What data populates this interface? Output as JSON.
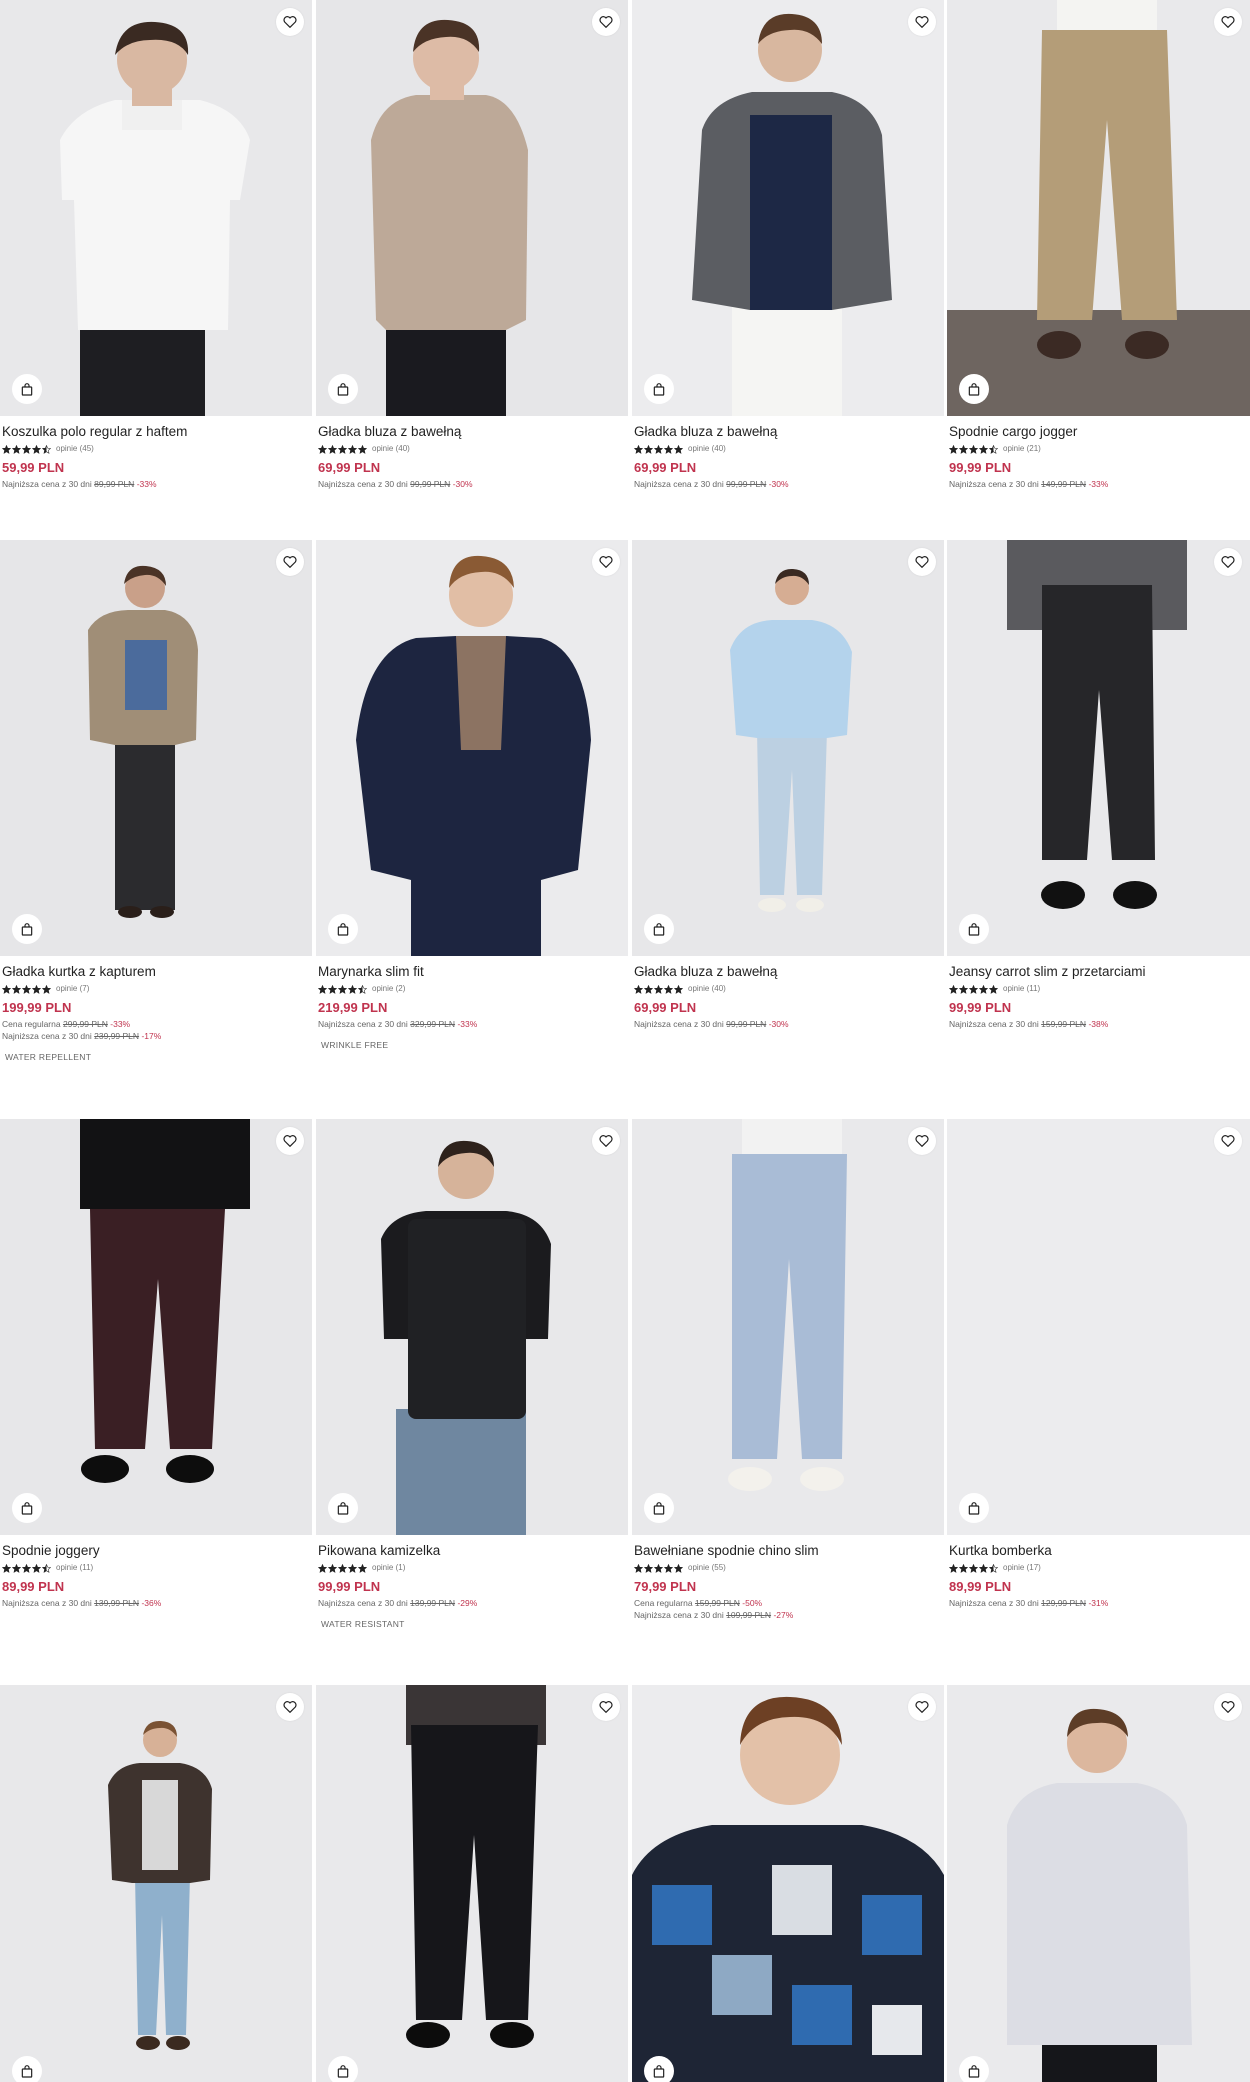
{
  "colors": {
    "accent_price": "#c0334e",
    "text": "#222222",
    "muted": "#777777",
    "card_bg": "#e9e9eb"
  },
  "icons": {
    "favorite": "heart-icon",
    "cart": "shopping-bag-icon",
    "star": "star-icon"
  },
  "products": [
    {
      "name": "Koszulka polo regular z haftem",
      "rating": 4.5,
      "reviews": "opinie (45)",
      "price": "59,99 PLN",
      "history": [
        {
          "label": "Najniższa cena z 30 dni",
          "old": "89,99 PLN",
          "discount": "-33%"
        }
      ],
      "tag": ""
    },
    {
      "name": "Gładka bluza z bawełną",
      "rating": 5,
      "reviews": "opinie (40)",
      "price": "69,99 PLN",
      "history": [
        {
          "label": "Najniższa cena z 30 dni",
          "old": "99,99 PLN",
          "discount": "-30%"
        }
      ],
      "tag": ""
    },
    {
      "name": "Gładka bluza z bawełną",
      "rating": 5,
      "reviews": "opinie (40)",
      "price": "69,99 PLN",
      "history": [
        {
          "label": "Najniższa cena z 30 dni",
          "old": "99,99 PLN",
          "discount": "-30%"
        }
      ],
      "tag": ""
    },
    {
      "name": "Spodnie cargo jogger",
      "rating": 4.5,
      "reviews": "opinie (21)",
      "price": "99,99 PLN",
      "history": [
        {
          "label": "Najniższa cena z 30 dni",
          "old": "149,99 PLN",
          "discount": "-33%"
        }
      ],
      "tag": ""
    },
    {
      "name": "Gładka kurtka z kapturem",
      "rating": 5,
      "reviews": "opinie (7)",
      "price": "199,99 PLN",
      "history": [
        {
          "label": "Cena regularna",
          "old": "299,99 PLN",
          "discount": "-33%"
        },
        {
          "label": "Najniższa cena z 30 dni",
          "old": "239,99 PLN",
          "discount": "-17%"
        }
      ],
      "tag": "WATER REPELLENT"
    },
    {
      "name": "Marynarka slim fit",
      "rating": 4.5,
      "reviews": "opinie (2)",
      "price": "219,99 PLN",
      "history": [
        {
          "label": "Najniższa cena z 30 dni",
          "old": "329,99 PLN",
          "discount": "-33%"
        }
      ],
      "tag": "WRINKLE FREE"
    },
    {
      "name": "Gładka bluza z bawełną",
      "rating": 5,
      "reviews": "opinie (40)",
      "price": "69,99 PLN",
      "history": [
        {
          "label": "Najniższa cena z 30 dni",
          "old": "99,99 PLN",
          "discount": "-30%"
        }
      ],
      "tag": ""
    },
    {
      "name": "Jeansy carrot slim z przetarciami",
      "rating": 5,
      "reviews": "opinie (11)",
      "price": "99,99 PLN",
      "history": [
        {
          "label": "Najniższa cena z 30 dni",
          "old": "159,99 PLN",
          "discount": "-38%"
        }
      ],
      "tag": ""
    },
    {
      "name": "Spodnie joggery",
      "rating": 4.5,
      "reviews": "opinie (11)",
      "price": "89,99 PLN",
      "history": [
        {
          "label": "Najniższa cena z 30 dni",
          "old": "139,99 PLN",
          "discount": "-36%"
        }
      ],
      "tag": ""
    },
    {
      "name": "Pikowana kamizelka",
      "rating": 5,
      "reviews": "opinie (1)",
      "price": "99,99 PLN",
      "history": [
        {
          "label": "Najniższa cena z 30 dni",
          "old": "139,99 PLN",
          "discount": "-29%"
        }
      ],
      "tag": "WATER RESISTANT"
    },
    {
      "name": "Bawełniane spodnie chino slim",
      "rating": 5,
      "reviews": "opinie (55)",
      "price": "79,99 PLN",
      "history": [
        {
          "label": "Cena regularna",
          "old": "159,99 PLN",
          "discount": "-50%"
        },
        {
          "label": "Najniższa cena z 30 dni",
          "old": "109,99 PLN",
          "discount": "-27%"
        }
      ],
      "tag": ""
    },
    {
      "name": "Kurtka bomberka",
      "rating": 4.5,
      "reviews": "opinie (17)",
      "price": "89,99 PLN",
      "history": [
        {
          "label": "Najniższa cena z 30 dni",
          "old": "129,99 PLN",
          "discount": "-31%"
        }
      ],
      "tag": ""
    },
    {
      "name": "",
      "rating": null,
      "reviews": "",
      "price": "",
      "history": [],
      "tag": ""
    },
    {
      "name": "",
      "rating": null,
      "reviews": "",
      "price": "",
      "history": [],
      "tag": ""
    },
    {
      "name": "",
      "rating": null,
      "reviews": "",
      "price": "",
      "history": [],
      "tag": ""
    },
    {
      "name": "",
      "rating": null,
      "reviews": "",
      "price": "",
      "history": [],
      "tag": ""
    }
  ]
}
